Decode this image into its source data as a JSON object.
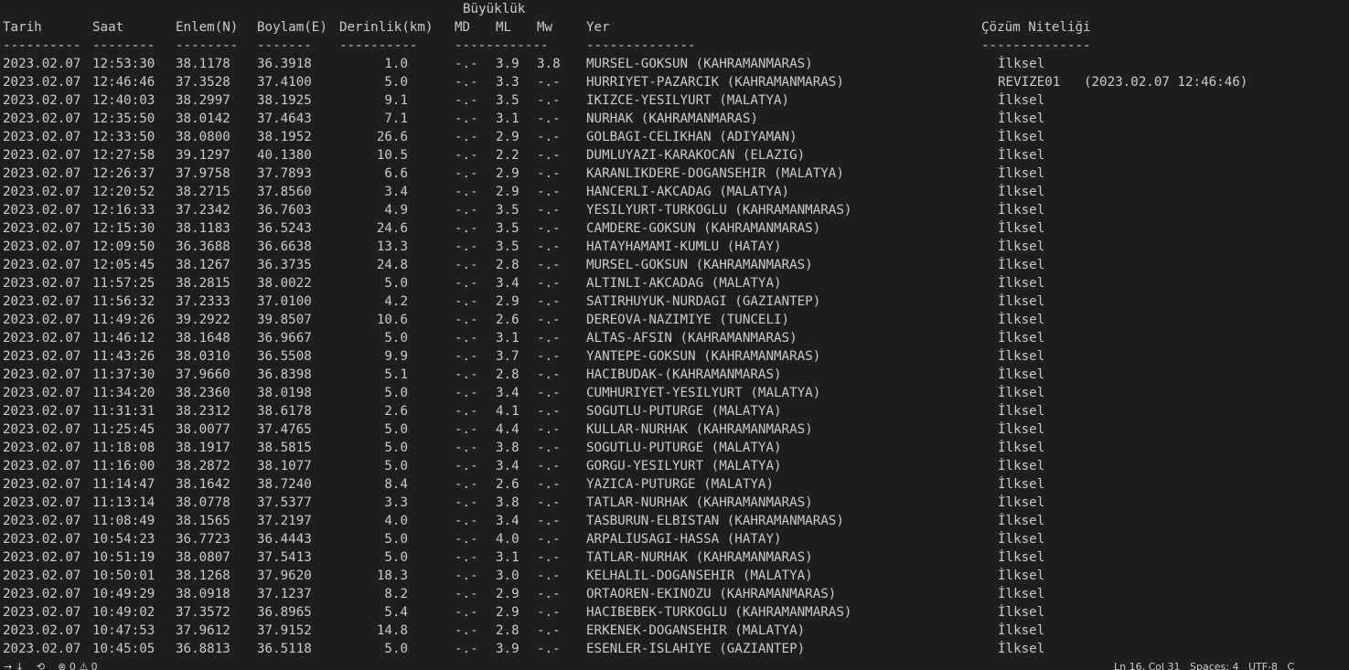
{
  "header": {
    "group_label": "Büyüklük",
    "columns": {
      "tarih": "Tarih",
      "saat": "Saat",
      "enlem": "Enlem(N)",
      "boylam": "Boylam(E)",
      "derinlik": "Derinlik(km)",
      "md": "MD",
      "ml": "ML",
      "mw": "Mw",
      "yer": "Yer",
      "cozum": "Çözüm Niteliği"
    },
    "separators": {
      "tarih": "----------",
      "saat": "--------",
      "enlem": "--------",
      "boylam": "-------",
      "derinlik": "----------",
      "buyukluk": "------------",
      "yer": "--------------",
      "cozum": "--------------"
    }
  },
  "rows": [
    {
      "tarih": "2023.02.07",
      "saat": "12:53:30",
      "enlem": "38.1178",
      "boylam": "36.3918",
      "derinlik": "1.0",
      "md": "-.-",
      "ml": "3.9",
      "mw": "3.8",
      "yer": "MURSEL-GOKSUN (KAHRAMANMARAS)",
      "cozum": "İlksel"
    },
    {
      "tarih": "2023.02.07",
      "saat": "12:46:46",
      "enlem": "37.3528",
      "boylam": "37.4100",
      "derinlik": "5.0",
      "md": "-.-",
      "ml": "3.3",
      "mw": "-.-",
      "yer": "HURRIYET-PAZARCIK (KAHRAMANMARAS)",
      "cozum": "REVIZE01   (2023.02.07 12:46:46)"
    },
    {
      "tarih": "2023.02.07",
      "saat": "12:40:03",
      "enlem": "38.2997",
      "boylam": "38.1925",
      "derinlik": "9.1",
      "md": "-.-",
      "ml": "3.5",
      "mw": "-.-",
      "yer": "IKIZCE-YESILYURT (MALATYA)",
      "cozum": "İlksel"
    },
    {
      "tarih": "2023.02.07",
      "saat": "12:35:50",
      "enlem": "38.0142",
      "boylam": "37.4643",
      "derinlik": "7.1",
      "md": "-.-",
      "ml": "3.1",
      "mw": "-.-",
      "yer": "NURHAK (KAHRAMANMARAS)",
      "cozum": "İlksel"
    },
    {
      "tarih": "2023.02.07",
      "saat": "12:33:50",
      "enlem": "38.0800",
      "boylam": "38.1952",
      "derinlik": "26.6",
      "md": "-.-",
      "ml": "2.9",
      "mw": "-.-",
      "yer": "GOLBAGI-CELIKHAN (ADIYAMAN)",
      "cozum": "İlksel"
    },
    {
      "tarih": "2023.02.07",
      "saat": "12:27:58",
      "enlem": "39.1297",
      "boylam": "40.1380",
      "derinlik": "10.5",
      "md": "-.-",
      "ml": "2.2",
      "mw": "-.-",
      "yer": "DUMLUYAZI-KARAKOCAN (ELAZIG)",
      "cozum": "İlksel"
    },
    {
      "tarih": "2023.02.07",
      "saat": "12:26:37",
      "enlem": "37.9758",
      "boylam": "37.7893",
      "derinlik": "6.6",
      "md": "-.-",
      "ml": "2.9",
      "mw": "-.-",
      "yer": "KARANLIKDERE-DOGANSEHIR (MALATYA)",
      "cozum": "İlksel"
    },
    {
      "tarih": "2023.02.07",
      "saat": "12:20:52",
      "enlem": "38.2715",
      "boylam": "37.8560",
      "derinlik": "3.4",
      "md": "-.-",
      "ml": "2.9",
      "mw": "-.-",
      "yer": "HANCERLI-AKCADAG (MALATYA)",
      "cozum": "İlksel"
    },
    {
      "tarih": "2023.02.07",
      "saat": "12:16:33",
      "enlem": "37.2342",
      "boylam": "36.7603",
      "derinlik": "4.9",
      "md": "-.-",
      "ml": "3.5",
      "mw": "-.-",
      "yer": "YESILYURT-TURKOGLU (KAHRAMANMARAS)",
      "cozum": "İlksel"
    },
    {
      "tarih": "2023.02.07",
      "saat": "12:15:30",
      "enlem": "38.1183",
      "boylam": "36.5243",
      "derinlik": "24.6",
      "md": "-.-",
      "ml": "3.5",
      "mw": "-.-",
      "yer": "CAMDERE-GOKSUN (KAHRAMANMARAS)",
      "cozum": "İlksel"
    },
    {
      "tarih": "2023.02.07",
      "saat": "12:09:50",
      "enlem": "36.3688",
      "boylam": "36.6638",
      "derinlik": "13.3",
      "md": "-.-",
      "ml": "3.5",
      "mw": "-.-",
      "yer": "HATAYHAMAMI-KUMLU (HATAY)",
      "cozum": "İlksel"
    },
    {
      "tarih": "2023.02.07",
      "saat": "12:05:45",
      "enlem": "38.1267",
      "boylam": "36.3735",
      "derinlik": "24.8",
      "md": "-.-",
      "ml": "2.8",
      "mw": "-.-",
      "yer": "MURSEL-GOKSUN (KAHRAMANMARAS)",
      "cozum": "İlksel"
    },
    {
      "tarih": "2023.02.07",
      "saat": "11:57:25",
      "enlem": "38.2815",
      "boylam": "38.0022",
      "derinlik": "5.0",
      "md": "-.-",
      "ml": "3.4",
      "mw": "-.-",
      "yer": "ALTINLI-AKCADAG (MALATYA)",
      "cozum": "İlksel"
    },
    {
      "tarih": "2023.02.07",
      "saat": "11:56:32",
      "enlem": "37.2333",
      "boylam": "37.0100",
      "derinlik": "4.2",
      "md": "-.-",
      "ml": "2.9",
      "mw": "-.-",
      "yer": "SATIRHUYUK-NURDAGI (GAZIANTEP)",
      "cozum": "İlksel"
    },
    {
      "tarih": "2023.02.07",
      "saat": "11:49:26",
      "enlem": "39.2922",
      "boylam": "39.8507",
      "derinlik": "10.6",
      "md": "-.-",
      "ml": "2.6",
      "mw": "-.-",
      "yer": "DEREOVA-NAZIMIYE (TUNCELI)",
      "cozum": "İlksel"
    },
    {
      "tarih": "2023.02.07",
      "saat": "11:46:12",
      "enlem": "38.1648",
      "boylam": "36.9667",
      "derinlik": "5.0",
      "md": "-.-",
      "ml": "3.1",
      "mw": "-.-",
      "yer": "ALTAS-AFSIN (KAHRAMANMARAS)",
      "cozum": "İlksel"
    },
    {
      "tarih": "2023.02.07",
      "saat": "11:43:26",
      "enlem": "38.0310",
      "boylam": "36.5508",
      "derinlik": "9.9",
      "md": "-.-",
      "ml": "3.7",
      "mw": "-.-",
      "yer": "YANTEPE-GOKSUN (KAHRAMANMARAS)",
      "cozum": "İlksel"
    },
    {
      "tarih": "2023.02.07",
      "saat": "11:37:30",
      "enlem": "37.9660",
      "boylam": "36.8398",
      "derinlik": "5.1",
      "md": "-.-",
      "ml": "2.8",
      "mw": "-.-",
      "yer": "HACIBUDAK-(KAHRAMANMARAS)",
      "cozum": "İlksel"
    },
    {
      "tarih": "2023.02.07",
      "saat": "11:34:20",
      "enlem": "38.2360",
      "boylam": "38.0198",
      "derinlik": "5.0",
      "md": "-.-",
      "ml": "3.4",
      "mw": "-.-",
      "yer": "CUMHURIYET-YESILYURT (MALATYA)",
      "cozum": "İlksel"
    },
    {
      "tarih": "2023.02.07",
      "saat": "11:31:31",
      "enlem": "38.2312",
      "boylam": "38.6178",
      "derinlik": "2.6",
      "md": "-.-",
      "ml": "4.1",
      "mw": "-.-",
      "yer": "SOGUTLU-PUTURGE (MALATYA)",
      "cozum": "İlksel"
    },
    {
      "tarih": "2023.02.07",
      "saat": "11:25:45",
      "enlem": "38.0077",
      "boylam": "37.4765",
      "derinlik": "5.0",
      "md": "-.-",
      "ml": "4.4",
      "mw": "-.-",
      "yer": "KULLAR-NURHAK (KAHRAMANMARAS)",
      "cozum": "İlksel"
    },
    {
      "tarih": "2023.02.07",
      "saat": "11:18:08",
      "enlem": "38.1917",
      "boylam": "38.5815",
      "derinlik": "5.0",
      "md": "-.-",
      "ml": "3.8",
      "mw": "-.-",
      "yer": "SOGUTLU-PUTURGE (MALATYA)",
      "cozum": "İlksel"
    },
    {
      "tarih": "2023.02.07",
      "saat": "11:16:00",
      "enlem": "38.2872",
      "boylam": "38.1077",
      "derinlik": "5.0",
      "md": "-.-",
      "ml": "3.4",
      "mw": "-.-",
      "yer": "GORGU-YESILYURT (MALATYA)",
      "cozum": "İlksel"
    },
    {
      "tarih": "2023.02.07",
      "saat": "11:14:47",
      "enlem": "38.1642",
      "boylam": "38.7240",
      "derinlik": "8.4",
      "md": "-.-",
      "ml": "2.6",
      "mw": "-.-",
      "yer": "YAZICA-PUTURGE (MALATYA)",
      "cozum": "İlksel"
    },
    {
      "tarih": "2023.02.07",
      "saat": "11:13:14",
      "enlem": "38.0778",
      "boylam": "37.5377",
      "derinlik": "3.3",
      "md": "-.-",
      "ml": "3.8",
      "mw": "-.-",
      "yer": "TATLAR-NURHAK (KAHRAMANMARAS)",
      "cozum": "İlksel"
    },
    {
      "tarih": "2023.02.07",
      "saat": "11:08:49",
      "enlem": "38.1565",
      "boylam": "37.2197",
      "derinlik": "4.0",
      "md": "-.-",
      "ml": "3.4",
      "mw": "-.-",
      "yer": "TASBURUN-ELBISTAN (KAHRAMANMARAS)",
      "cozum": "İlksel"
    },
    {
      "tarih": "2023.02.07",
      "saat": "10:54:23",
      "enlem": "36.7723",
      "boylam": "36.4443",
      "derinlik": "5.0",
      "md": "-.-",
      "ml": "4.0",
      "mw": "-.-",
      "yer": "ARPALIUSAGI-HASSA (HATAY)",
      "cozum": "İlksel"
    },
    {
      "tarih": "2023.02.07",
      "saat": "10:51:19",
      "enlem": "38.0807",
      "boylam": "37.5413",
      "derinlik": "5.0",
      "md": "-.-",
      "ml": "3.1",
      "mw": "-.-",
      "yer": "TATLAR-NURHAK (KAHRAMANMARAS)",
      "cozum": "İlksel"
    },
    {
      "tarih": "2023.02.07",
      "saat": "10:50:01",
      "enlem": "38.1268",
      "boylam": "37.9620",
      "derinlik": "18.3",
      "md": "-.-",
      "ml": "3.0",
      "mw": "-.-",
      "yer": "KELHALIL-DOGANSEHIR (MALATYA)",
      "cozum": "İlksel"
    },
    {
      "tarih": "2023.02.07",
      "saat": "10:49:29",
      "enlem": "38.0918",
      "boylam": "37.1237",
      "derinlik": "8.2",
      "md": "-.-",
      "ml": "2.9",
      "mw": "-.-",
      "yer": "ORTAOREN-EKINOZU (KAHRAMANMARAS)",
      "cozum": "İlksel"
    },
    {
      "tarih": "2023.02.07",
      "saat": "10:49:02",
      "enlem": "37.3572",
      "boylam": "36.8965",
      "derinlik": "5.4",
      "md": "-.-",
      "ml": "2.9",
      "mw": "-.-",
      "yer": "HACIBEBEK-TURKOGLU (KAHRAMANMARAS)",
      "cozum": "İlksel"
    },
    {
      "tarih": "2023.02.07",
      "saat": "10:47:53",
      "enlem": "37.9612",
      "boylam": "37.9152",
      "derinlik": "14.8",
      "md": "-.-",
      "ml": "2.8",
      "mw": "-.-",
      "yer": "ERKENEK-DOGANSEHIR (MALATYA)",
      "cozum": "İlksel"
    },
    {
      "tarih": "2023.02.07",
      "saat": "10:45:05",
      "enlem": "36.8813",
      "boylam": "36.5118",
      "derinlik": "5.0",
      "md": "-.-",
      "ml": "3.9",
      "mw": "-.-",
      "yer": "ESENLER-ISLAHIYE (GAZIANTEP)",
      "cozum": "İlksel"
    }
  ],
  "statusbar": {
    "left_glyphs": "→ ↓    ⟲    ⊗ 0 ⚠ 0",
    "right_text": "Ln 16, Col 31   Spaces: 4   UTF-8   C"
  }
}
